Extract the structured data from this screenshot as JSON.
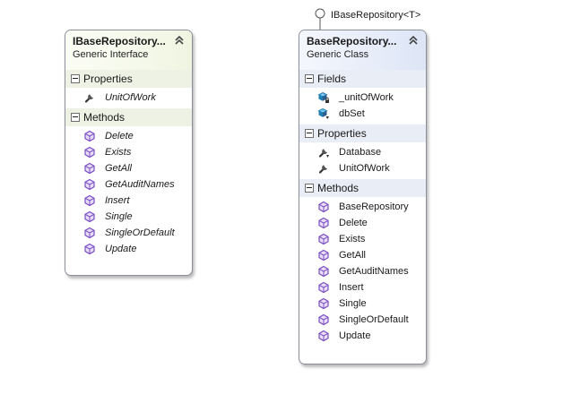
{
  "interface_shape": {
    "title": "IBaseRepository...",
    "kind": "Generic Interface",
    "sections": [
      {
        "name": "Properties",
        "members": [
          {
            "label": "UnitOfWork",
            "icon": "property-icon"
          }
        ]
      },
      {
        "name": "Methods",
        "members": [
          {
            "label": "Delete",
            "icon": "method-icon"
          },
          {
            "label": "Exists",
            "icon": "method-icon"
          },
          {
            "label": "GetAll",
            "icon": "method-icon"
          },
          {
            "label": "GetAuditNames",
            "icon": "method-icon"
          },
          {
            "label": "Insert",
            "icon": "method-icon"
          },
          {
            "label": "Single",
            "icon": "method-icon"
          },
          {
            "label": "SingleOrDefault",
            "icon": "method-icon"
          },
          {
            "label": "Update",
            "icon": "method-icon"
          }
        ]
      }
    ]
  },
  "class_shape": {
    "title": "BaseRepository...",
    "kind": "Generic Class",
    "implements_label": "IBaseRepository<T>",
    "sections": [
      {
        "name": "Fields",
        "members": [
          {
            "label": "_unitOfWork",
            "icon": "private-field-icon"
          },
          {
            "label": "dbSet",
            "icon": "protected-field-icon"
          }
        ]
      },
      {
        "name": "Properties",
        "members": [
          {
            "label": "Database",
            "icon": "protected-property-icon"
          },
          {
            "label": "UnitOfWork",
            "icon": "property-icon"
          }
        ]
      },
      {
        "name": "Methods",
        "members": [
          {
            "label": "BaseRepository",
            "icon": "method-icon"
          },
          {
            "label": "Delete",
            "icon": "method-icon"
          },
          {
            "label": "Exists",
            "icon": "method-icon"
          },
          {
            "label": "GetAll",
            "icon": "method-icon"
          },
          {
            "label": "GetAuditNames",
            "icon": "method-icon"
          },
          {
            "label": "Insert",
            "icon": "method-icon"
          },
          {
            "label": "Single",
            "icon": "method-icon"
          },
          {
            "label": "SingleOrDefault",
            "icon": "method-icon"
          },
          {
            "label": "Update",
            "icon": "method-icon"
          }
        ]
      }
    ]
  },
  "colors": {
    "interface_header": "#f0f5e2",
    "class_header": "#dde5f6",
    "method_icon": "#7a4fc2",
    "field_icon": "#1f7fb5",
    "border": "#8a8f99"
  }
}
